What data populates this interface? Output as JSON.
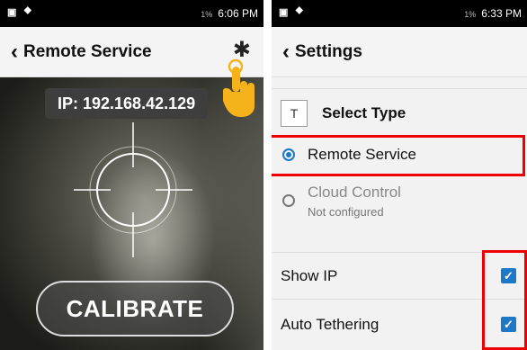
{
  "left": {
    "status": {
      "battery": "1%",
      "time": "6:06 PM"
    },
    "appbar": {
      "back_icon": "chevron-left-icon",
      "title": "Remote Service",
      "settings_icon": "gear-icon"
    },
    "camera": {
      "ip_label": "IP: 192.168.42.129",
      "calibrate_label": "CALIBRATE"
    }
  },
  "right": {
    "status": {
      "battery": "1%",
      "time": "6:33 PM"
    },
    "appbar": {
      "back_icon": "chevron-left-icon",
      "title": "Settings"
    },
    "select_type": {
      "icon_letter": "T",
      "title": "Select Type"
    },
    "options": [
      {
        "label": "Remote Service",
        "selected": true
      },
      {
        "label": "Cloud Control",
        "subtitle": "Not configured",
        "selected": false
      }
    ],
    "toggles": [
      {
        "label": "Show IP",
        "checked": true
      },
      {
        "label": "Auto Tethering",
        "checked": true
      }
    ]
  },
  "colors": {
    "accent": "#1e78c8",
    "highlight": "#e00000",
    "pointer_hand": "#f5b21a"
  }
}
